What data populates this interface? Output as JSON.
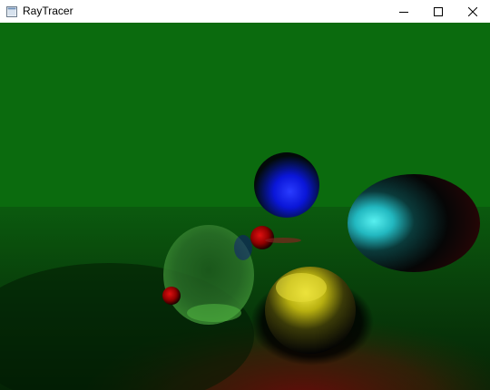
{
  "window": {
    "title": "RayTracer",
    "icon": "window-app-icon",
    "controls": [
      {
        "name": "minimize",
        "icon": "minimize-icon"
      },
      {
        "name": "maximize",
        "icon": "maximize-icon"
      },
      {
        "name": "close",
        "icon": "close-icon"
      }
    ]
  },
  "scene": {
    "sky_color": "#0b6b0e",
    "floor_color": "#0a4a0c",
    "objects": [
      {
        "name": "blue-sphere",
        "color": "#1020ff"
      },
      {
        "name": "cyan-sphere",
        "color": "#40e0e0"
      },
      {
        "name": "yellow-sphere",
        "color": "#d8d020"
      },
      {
        "name": "glass-sphere",
        "color": "#2a6a2a"
      },
      {
        "name": "red-sphere-large",
        "color": "#c00000"
      },
      {
        "name": "red-sphere-small",
        "color": "#a00000"
      }
    ]
  }
}
